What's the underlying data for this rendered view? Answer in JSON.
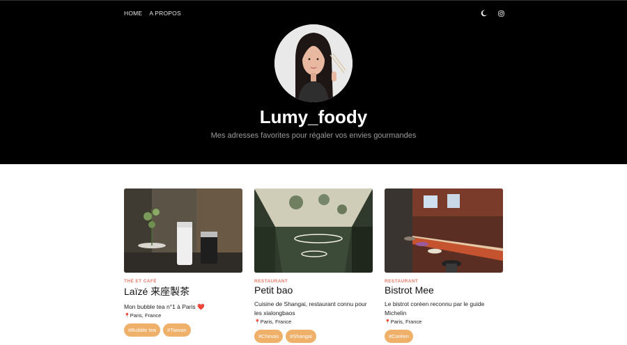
{
  "nav": {
    "links": [
      "HOME",
      "A PROPOS"
    ],
    "icons": [
      "moon-icon",
      "instagram-icon"
    ]
  },
  "hero": {
    "title": "Lumy_foody",
    "subtitle": "Mes adresses favorites pour régaler vos envies gourmandes"
  },
  "cards": [
    {
      "category": "THÉ ET CAFÉ",
      "name": "Laïzé 来座製茶",
      "description": "Mon bubble tea n°1 à Paris ❤️",
      "location": "Paris, France",
      "tags": [
        "#Bubble tea",
        "#Taiwan"
      ]
    },
    {
      "category": "RESTAURANT",
      "name": "Petit bao",
      "description": "Cuisine de Shangai, restaurant connu pour les xialongbaos",
      "location": "Paris, France",
      "tags": [
        "#Chinois",
        "#Shangai"
      ]
    },
    {
      "category": "RESTAURANT",
      "name": "Bistrot Mee",
      "description": "Le bistrot coréen reconnu par le guide Michelin",
      "location": "Paris, France",
      "tags": [
        "#Coréen"
      ]
    }
  ],
  "colors": {
    "accent_tag": "#efb06a",
    "category_text": "#e77c6a",
    "hero_bg": "#000000"
  }
}
